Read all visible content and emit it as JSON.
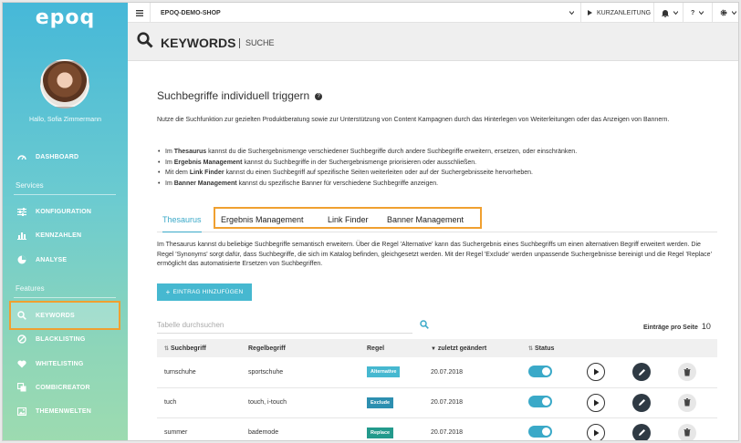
{
  "sidebar": {
    "logo": "epoq",
    "greeting": "Hallo, Sofia Zimmermann",
    "dashboard": "DASHBOARD",
    "services_label": "Services",
    "konfiguration": "KONFIGURATION",
    "kennzahlen": "KENNZAHLEN",
    "analyse": "ANALYSE",
    "features_label": "Features",
    "keywords": "KEYWORDS",
    "blacklisting": "BLACKLISTING",
    "whitelisting": "WHITELISTING",
    "combicreator": "COMBICREATOR",
    "themenwelten": "THEMENWELTEN"
  },
  "topbar": {
    "shop": "EPOQ-DEMO-SHOP",
    "guide": "KURZANLEITUNG",
    "help": "?"
  },
  "header": {
    "title": "KEYWORDS",
    "subtitle": "SUCHE"
  },
  "content": {
    "heading": "Suchbegriffe individuell triggern",
    "intro": "Nutze die Suchfunktion zur gezielten Produktberatung sowie zur Unterstützung von Content Kampagnen durch das Hinterlegen von Weiterleitungen oder das Anzeigen von Bannern.",
    "bullets": [
      {
        "pre": "Im ",
        "bold": "Thesaurus",
        "post": " kannst du die Suchergebnismenge verschiedener Suchbegriffe durch andere Suchbegriffe erweitern, ersetzen, oder einschränken."
      },
      {
        "pre": "Im ",
        "bold": "Ergebnis Management",
        "post": " kannst du Suchbegriffe in der Suchergebnismenge priorisieren oder ausschließen."
      },
      {
        "pre": "Mit dem ",
        "bold": "Link Finder",
        "post": " kannst du einen Suchbegriff auf spezifische Seiten weiterleiten oder auf der Suchergebnisseite hervorheben."
      },
      {
        "pre": "Im ",
        "bold": "Banner Management",
        "post": " kannst du spezifische Banner für verschiedene Suchbegriffe anzeigen."
      }
    ],
    "tabs": [
      "Thesaurus",
      "Ergebnis Management",
      "Link Finder",
      "Banner Management"
    ],
    "thesaurus_text": "Im Thesaurus kannst du beliebige Suchbegriffe semantisch erweitern. Über die Regel 'Alternative' kann das Suchergebnis eines Suchbegriffs um einen alternativen Begriff erweitert werden. Die Regel 'Synonyms' sorgt dafür, dass Suchbegriffe, die sich im Katalog befinden, gleichgesetzt werden. Mit der Regel 'Exclude' werden unpassende Suchergebnisse bereinigt und die Regel 'Replace' ermöglicht das automatisierte Ersetzen von Suchbegriffen.",
    "add_button": "EINTRAG HINZUFÜGEN",
    "table_search_placeholder": "Tabelle durchsuchen",
    "per_page_label": "Einträge pro Seite",
    "per_page_value": "10"
  },
  "table": {
    "headers": [
      "Suchbegriff",
      "Regelbegriff",
      "Regel",
      "zuletzt geändert",
      "Status"
    ],
    "rows": [
      {
        "term": "turnschuhe",
        "rule_term": "sportschuhe",
        "rule": "Alternative",
        "rule_color": "#46b8d0",
        "date": "20.07.2018"
      },
      {
        "term": "tuch",
        "rule_term": "touch, i-touch",
        "rule": "Exclude",
        "rule_color": "#2d8fb0",
        "date": "20.07.2018"
      },
      {
        "term": "summer",
        "rule_term": "bademode",
        "rule": "Replace",
        "rule_color": "#239a8c",
        "date": "20.07.2018"
      }
    ]
  },
  "colors": {
    "accent": "#3aa9c8",
    "highlight": "#f0a030"
  }
}
